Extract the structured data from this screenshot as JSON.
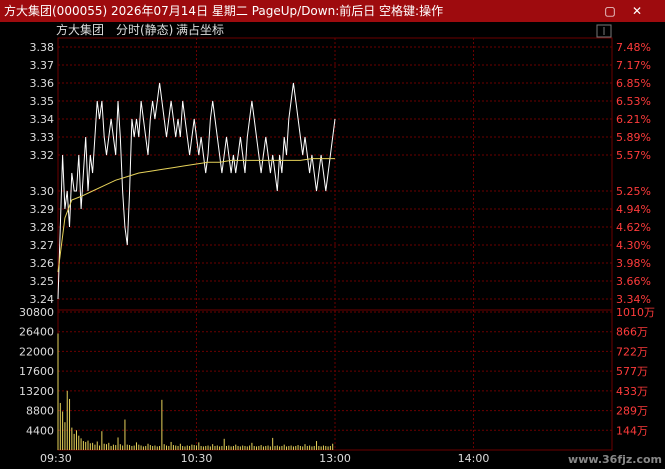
{
  "window": {
    "title": "方大集团(000055)  2026年07月14日  星期二  PageUp/Down:前后日  空格键:操作",
    "close_label": "✕",
    "restore_label": "▢"
  },
  "chart_header": {
    "stock_name": "方大集团",
    "mode_label": "分时(静态)",
    "fill_label": "满占坐标"
  },
  "watermark": "www.36fjz.com",
  "colors": {
    "background": "#000000",
    "title_bar": "#9e0b0e",
    "grid": "#6b0000",
    "price_line": "#ffffff",
    "avg_line": "#e6d25a",
    "up_text": "#ff3b3b",
    "volume_bar": "#e6d25a"
  },
  "chart_data": [
    {
      "type": "line",
      "title": "",
      "y_ticks": [
        "3.38",
        "3.37",
        "3.36",
        "3.35",
        "3.34",
        "3.33",
        "3.32",
        "3.30",
        "3.29",
        "3.28",
        "3.27",
        "3.26",
        "3.25",
        "3.24"
      ],
      "pct_ticks": [
        "7.48%",
        "7.17%",
        "6.85%",
        "6.53%",
        "6.21%",
        "5.89%",
        "5.57%",
        "5.25%",
        "4.94%",
        "4.62%",
        "4.30%",
        "3.98%",
        "3.66%",
        "3.34%"
      ],
      "ylim": [
        3.235,
        3.385
      ],
      "x_ticks": [
        "09:30",
        "10:30",
        "13:00",
        "14:00"
      ],
      "x_tick_minutes": [
        0,
        60,
        120,
        180
      ],
      "x_total_minutes": 240,
      "series": [
        {
          "role": "price",
          "x": [
            0,
            1,
            2,
            3,
            4,
            5,
            6,
            7,
            8,
            9,
            10,
            11,
            12,
            13,
            14,
            15,
            16,
            17,
            18,
            19,
            20,
            21,
            22,
            23,
            24,
            25,
            26,
            27,
            28,
            29,
            30,
            31,
            32,
            33,
            34,
            35,
            36,
            37,
            38,
            39,
            40,
            41,
            42,
            43,
            44,
            45,
            46,
            47,
            48,
            49,
            50,
            51,
            52,
            53,
            54,
            55,
            56,
            57,
            58,
            59,
            60,
            61,
            62,
            63,
            64,
            65,
            66,
            67,
            68,
            69,
            70,
            71,
            72,
            73,
            74,
            75,
            76,
            77,
            78,
            79,
            80,
            81,
            82,
            83,
            84,
            85,
            86,
            87,
            88,
            89,
            90,
            91,
            92,
            93,
            94,
            95,
            96,
            97,
            98,
            99,
            100,
            101,
            102,
            103,
            104,
            105,
            106,
            107,
            108,
            109,
            110,
            111,
            112,
            113,
            114,
            115,
            116,
            117,
            118,
            119,
            120
          ],
          "values": [
            3.24,
            3.28,
            3.32,
            3.29,
            3.3,
            3.28,
            3.31,
            3.3,
            3.3,
            3.32,
            3.29,
            3.31,
            3.33,
            3.3,
            3.32,
            3.31,
            3.33,
            3.35,
            3.34,
            3.35,
            3.33,
            3.32,
            3.33,
            3.34,
            3.33,
            3.32,
            3.35,
            3.33,
            3.3,
            3.28,
            3.27,
            3.3,
            3.34,
            3.33,
            3.34,
            3.33,
            3.35,
            3.34,
            3.33,
            3.32,
            3.34,
            3.35,
            3.34,
            3.35,
            3.36,
            3.35,
            3.34,
            3.33,
            3.34,
            3.35,
            3.34,
            3.33,
            3.34,
            3.33,
            3.35,
            3.34,
            3.33,
            3.32,
            3.33,
            3.34,
            3.33,
            3.32,
            3.33,
            3.32,
            3.31,
            3.32,
            3.34,
            3.35,
            3.34,
            3.33,
            3.32,
            3.31,
            3.32,
            3.33,
            3.32,
            3.31,
            3.32,
            3.31,
            3.32,
            3.33,
            3.32,
            3.31,
            3.33,
            3.34,
            3.35,
            3.34,
            3.33,
            3.32,
            3.31,
            3.32,
            3.33,
            3.32,
            3.31,
            3.32,
            3.31,
            3.3,
            3.32,
            3.31,
            3.33,
            3.32,
            3.34,
            3.35,
            3.36,
            3.35,
            3.34,
            3.33,
            3.32,
            3.33,
            3.32,
            3.31,
            3.32,
            3.31,
            3.3,
            3.31,
            3.32,
            3.31,
            3.3,
            3.31,
            3.32,
            3.33,
            3.34
          ]
        },
        {
          "role": "average",
          "x": [
            0,
            3,
            6,
            10,
            15,
            20,
            25,
            30,
            35,
            40,
            45,
            50,
            55,
            60,
            65,
            70,
            75,
            80,
            85,
            90,
            95,
            100,
            105,
            110,
            115,
            120
          ],
          "values": [
            3.255,
            3.285,
            3.295,
            3.297,
            3.3,
            3.303,
            3.306,
            3.308,
            3.31,
            3.311,
            3.312,
            3.313,
            3.314,
            3.315,
            3.316,
            3.316,
            3.317,
            3.317,
            3.317,
            3.317,
            3.317,
            3.317,
            3.317,
            3.318,
            3.318,
            3.318
          ]
        }
      ]
    },
    {
      "type": "bar",
      "title": "",
      "y_ticks": [
        "30800",
        "26400",
        "22000",
        "17600",
        "13200",
        "8800",
        "4400"
      ],
      "right_ticks": [
        "1010万",
        "866万",
        "722万",
        "577万",
        "433万",
        "289万",
        "144万"
      ],
      "ylim": [
        0,
        30800
      ],
      "x_total_minutes": 240,
      "volumes": [
        26000,
        10500,
        8600,
        6200,
        13200,
        11400,
        5000,
        3600,
        4400,
        3200,
        2600,
        2000,
        1800,
        2100,
        1500,
        1600,
        1200,
        1900,
        1000,
        4200,
        1400,
        1300,
        1600,
        900,
        1200,
        1100,
        2800,
        1300,
        1000,
        6800,
        1200,
        1100,
        900,
        1000,
        1700,
        1200,
        1000,
        800,
        900,
        1400,
        1100,
        900,
        1000,
        800,
        900,
        11200,
        1300,
        1000,
        900,
        1800,
        1100,
        1000,
        900,
        1400,
        900,
        800,
        1000,
        900,
        1200,
        1100,
        1000,
        1700,
        900,
        800,
        900,
        1000,
        800,
        1300,
        900,
        1000,
        800,
        900,
        2500,
        900,
        1000,
        800,
        900,
        1200,
        900,
        800,
        1000,
        900,
        800,
        1000,
        1600,
        900,
        800,
        900,
        1100,
        800,
        900,
        1000,
        800,
        2700,
        900,
        1000,
        800,
        900,
        1200,
        800,
        900,
        1000,
        800,
        900,
        1100,
        900,
        800,
        1300,
        900,
        1000,
        800,
        900,
        2000,
        900,
        800,
        1000,
        900,
        800,
        900,
        1400
      ]
    }
  ]
}
